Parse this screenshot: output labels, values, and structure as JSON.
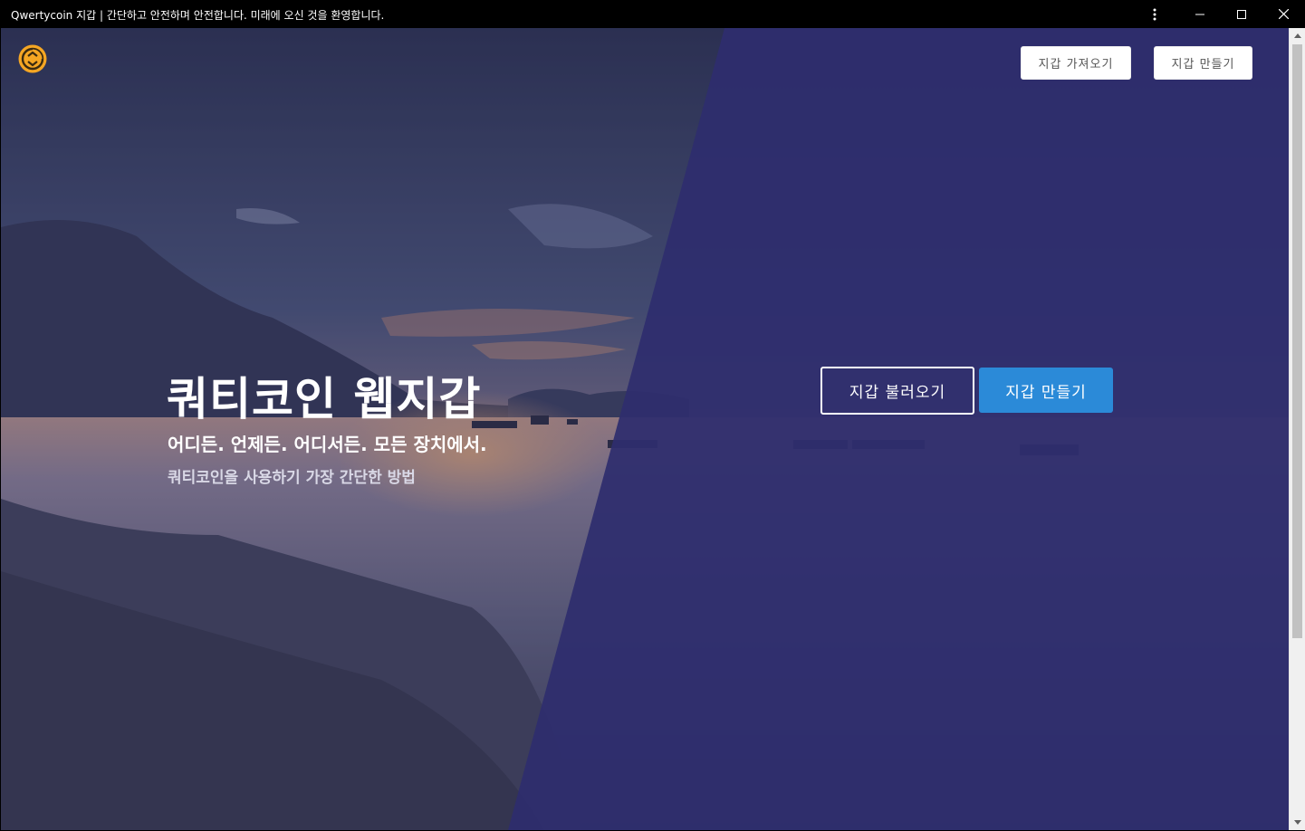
{
  "window": {
    "title": "Qwertycoin 지갑 | 간단하고 안전하며 안전합니다. 미래에 오신 것을 환영합니다.",
    "controls": {
      "menu_icon": "more-vertical-icon",
      "minimize_icon": "minimize-icon",
      "maximize_icon": "maximize-icon",
      "close_icon": "close-icon"
    }
  },
  "header": {
    "logo_icon": "qwertycoin-logo-icon",
    "import_wallet_label": "지갑 가져오기",
    "create_wallet_label": "지갑 만들기"
  },
  "hero": {
    "title": "쿼티코인 웹지갑",
    "subtitle": "어디든. 언제든. 어디서든. 모든 장치에서.",
    "description": "쿼티코인을 사용하기 가장 간단한 방법",
    "load_wallet_label": "지갑 불러오기",
    "make_wallet_label": "지갑 만들기"
  },
  "colors": {
    "overlay": "#2e2d6e",
    "primary_button": "#2b8ad8",
    "logo": "#f5a623"
  }
}
